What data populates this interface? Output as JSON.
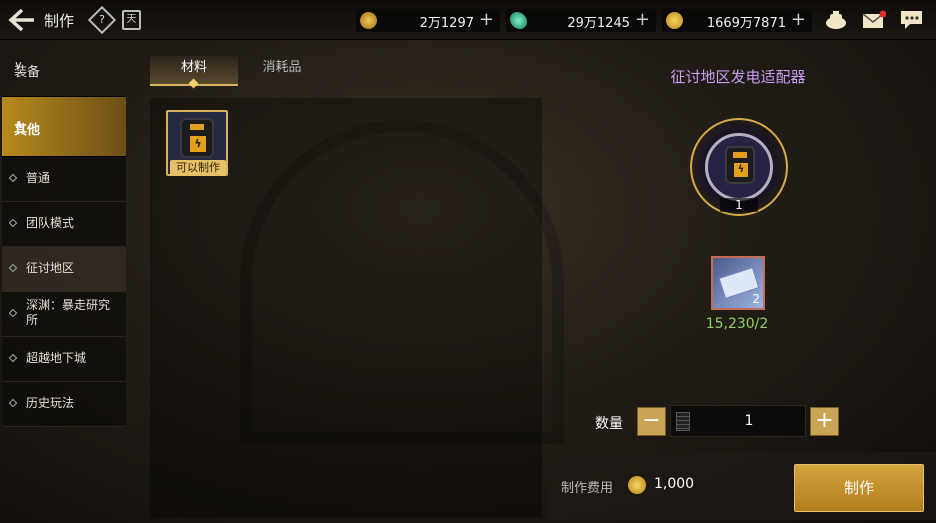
{
  "header": {
    "title": "制作",
    "calendar_glyph": "天"
  },
  "currencies": [
    {
      "icon": "gold-c-coin-icon",
      "value": "2万1297"
    },
    {
      "icon": "green-crystal-icon",
      "value": "29万1245"
    },
    {
      "icon": "gold-coin-icon",
      "value": "1669万7871"
    }
  ],
  "sidebar": {
    "categories": [
      {
        "label": "装备",
        "expanded": false
      },
      {
        "label": "其他",
        "expanded": true
      }
    ],
    "subitems": [
      {
        "label": "普通"
      },
      {
        "label": "团队模式"
      },
      {
        "label": "征讨地区",
        "selected": true
      },
      {
        "label": "深渊：暴走研究所"
      },
      {
        "label": "超越地下城"
      },
      {
        "label": "历史玩法"
      }
    ]
  },
  "tabs": [
    {
      "label": "材料",
      "active": true
    },
    {
      "label": "消耗品",
      "active": false
    }
  ],
  "items": [
    {
      "badge": "可以制作",
      "icon": "power-adapter-icon"
    }
  ],
  "detail": {
    "name": "征讨地区发电适配器",
    "result_count": "1",
    "material": {
      "icon": "material-ticket-icon",
      "count": "2",
      "owned_required": "15,230/2"
    }
  },
  "quantity": {
    "label": "数量",
    "minus": "−",
    "plus": "+",
    "value": "1"
  },
  "cost": {
    "label": "制作费用",
    "value": "1,000"
  },
  "make_button": "制作",
  "colors": {
    "accent": "#d4a43f",
    "title_purple": "#c99bf2",
    "material_green": "#8fd05c"
  }
}
